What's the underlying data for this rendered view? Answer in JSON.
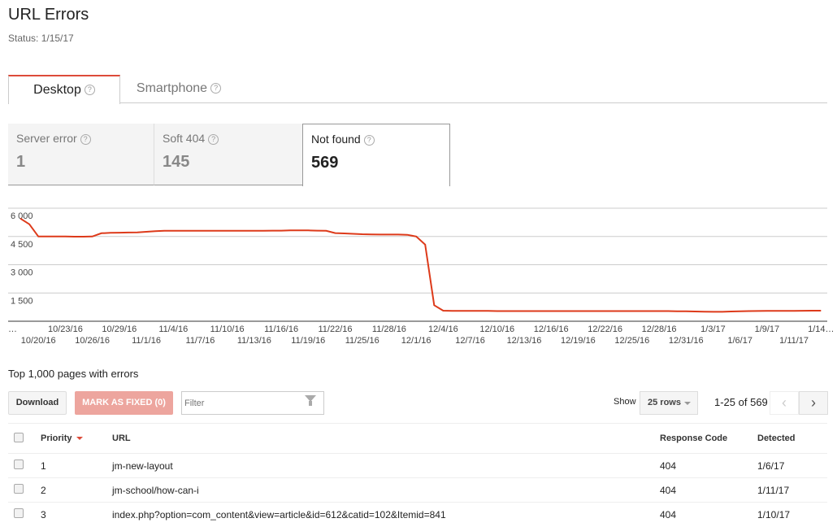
{
  "header": {
    "title": "URL Errors",
    "status": "Status: 1/15/17"
  },
  "tabs": [
    {
      "label": "Desktop",
      "active": true,
      "help_icon": "question-circle-icon"
    },
    {
      "label": "Smartphone",
      "active": false,
      "help_icon": "question-circle-icon"
    }
  ],
  "cards": [
    {
      "label": "Server error",
      "value": "1"
    },
    {
      "label": "Soft 404",
      "value": "145"
    },
    {
      "label": "Not found",
      "value": "569",
      "selected": true
    }
  ],
  "chart_data": {
    "type": "line",
    "title": "",
    "xlabel": "",
    "ylabel": "",
    "ylim": [
      0,
      6000
    ],
    "grid": true,
    "line_color": "#dd3a1a",
    "y_ticks": [
      "6 000",
      "4 500",
      "3 000",
      "1 500"
    ],
    "y_tick_values": [
      6000,
      4500,
      3000,
      1500
    ],
    "x_tick_labels": [
      "…",
      "10/20/16",
      "10/23/16",
      "10/26/16",
      "10/29/16",
      "11/1/16",
      "11/4/16",
      "11/7/16",
      "11/10/16",
      "11/13/16",
      "11/16/16",
      "11/19/16",
      "11/22/16",
      "11/25/16",
      "11/28/16",
      "12/1/16",
      "12/4/16",
      "12/7/16",
      "12/10/16",
      "12/13/16",
      "12/16/16",
      "12/19/16",
      "12/22/16",
      "12/25/16",
      "12/28/16",
      "12/31/16",
      "1/3/17",
      "1/6/17",
      "1/9/17",
      "1/11/17",
      "1/14…"
    ],
    "x": [
      "10/18/16",
      "10/19/16",
      "10/20/16",
      "10/21/16",
      "10/22/16",
      "10/23/16",
      "10/24/16",
      "10/25/16",
      "10/26/16",
      "10/27/16",
      "10/28/16",
      "10/29/16",
      "10/30/16",
      "10/31/16",
      "11/1/16",
      "11/2/16",
      "11/3/16",
      "11/4/16",
      "11/5/16",
      "11/6/16",
      "11/7/16",
      "11/8/16",
      "11/9/16",
      "11/10/16",
      "11/11/16",
      "11/12/16",
      "11/13/16",
      "11/14/16",
      "11/15/16",
      "11/16/16",
      "11/17/16",
      "11/18/16",
      "11/19/16",
      "11/20/16",
      "11/21/16",
      "11/22/16",
      "11/23/16",
      "11/24/16",
      "11/25/16",
      "11/26/16",
      "11/27/16",
      "11/28/16",
      "11/29/16",
      "11/30/16",
      "12/1/16",
      "12/2/16",
      "12/3/16",
      "12/4/16",
      "12/5/16",
      "12/6/16",
      "12/7/16",
      "12/8/16",
      "12/9/16",
      "12/10/16",
      "12/11/16",
      "12/12/16",
      "12/13/16",
      "12/14/16",
      "12/15/16",
      "12/16/16",
      "12/17/16",
      "12/18/16",
      "12/19/16",
      "12/20/16",
      "12/21/16",
      "12/22/16",
      "12/23/16",
      "12/24/16",
      "12/25/16",
      "12/26/16",
      "12/27/16",
      "12/28/16",
      "12/29/16",
      "12/30/16",
      "12/31/16",
      "1/1/17",
      "1/2/17",
      "1/3/17",
      "1/4/17",
      "1/5/17",
      "1/6/17",
      "1/7/17",
      "1/8/17",
      "1/9/17",
      "1/10/17",
      "1/11/17",
      "1/12/17",
      "1/13/17",
      "1/14/17",
      "1/15/17"
    ],
    "values": [
      5450,
      5150,
      4500,
      4500,
      4500,
      4500,
      4490,
      4490,
      4500,
      4670,
      4690,
      4700,
      4710,
      4720,
      4750,
      4780,
      4800,
      4800,
      4800,
      4800,
      4800,
      4800,
      4800,
      4800,
      4800,
      4800,
      4800,
      4800,
      4810,
      4810,
      4820,
      4820,
      4820,
      4810,
      4800,
      4680,
      4660,
      4640,
      4620,
      4610,
      4600,
      4600,
      4600,
      4590,
      4500,
      4070,
      850,
      560,
      550,
      550,
      550,
      550,
      550,
      540,
      540,
      540,
      540,
      540,
      540,
      540,
      540,
      540,
      540,
      540,
      540,
      540,
      540,
      540,
      540,
      540,
      540,
      540,
      540,
      530,
      530,
      520,
      510,
      500,
      500,
      520,
      530,
      540,
      545,
      550,
      550,
      550,
      550,
      555,
      560,
      560
    ]
  },
  "list": {
    "title": "Top 1,000 pages with errors",
    "download_label": "Download",
    "mark_fixed_label": "MARK AS FIXED (0)",
    "filter_placeholder": "Filter",
    "show_label": "Show",
    "rows_select": "25 rows",
    "range": "1-25 of 569",
    "prev": "‹",
    "next": "›",
    "columns": [
      "Priority",
      "URL",
      "Response Code",
      "Detected"
    ],
    "rows": [
      {
        "priority": "1",
        "url": "jm-new-layout",
        "code": "404",
        "detected": "1/6/17"
      },
      {
        "priority": "2",
        "url": "jm-school/how-can-i",
        "code": "404",
        "detected": "1/11/17"
      },
      {
        "priority": "3",
        "url": "index.php?option=com_content&view=article&id=612&catid=102&Itemid=841",
        "code": "404",
        "detected": "1/10/17"
      }
    ]
  }
}
